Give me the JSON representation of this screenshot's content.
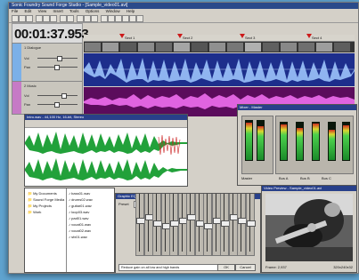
{
  "app": {
    "title": "Sonic Foundry Sound Forge Studio - [Sample_video01.avi]",
    "menu": [
      "File",
      "Edit",
      "View",
      "Insert",
      "Tools",
      "Options",
      "Window",
      "Help"
    ]
  },
  "transport": {
    "time": "00:01:37.953"
  },
  "tracks": [
    {
      "name": "1 Dialogue",
      "vol_label": "Vol",
      "pan_label": "Pan"
    },
    {
      "name": "2 Music",
      "vol_label": "Vol",
      "pan_label": "Pan"
    }
  ],
  "ruler": {
    "markers": [
      "Sect 1",
      "Sect 2",
      "Sect 3",
      "Sect 4"
    ]
  },
  "wave_window": {
    "title": "Intro.wav - 44,100 Hz, 16-bit, Stereo"
  },
  "mixer_window": {
    "title": "Mixer - Master",
    "labels": [
      "Master",
      "Bus A",
      "Bus B",
      "Bus C"
    ]
  },
  "explorer": {
    "items": [
      "My Documents",
      "Sound Forge Media",
      "My Projects",
      "Work"
    ],
    "files": [
      "bass01.wav",
      "drums02.wav",
      "guitar01.wav",
      "loop03.wav",
      "pad01.wav",
      "vocal01.wav",
      "vocal02.wav",
      "sfx01.wav"
    ]
  },
  "eq_window": {
    "title": "Graphic EQ",
    "preset_label": "Preset",
    "preset_value": "[Untitled]",
    "bands": [
      0.55,
      0.6,
      0.5,
      0.45,
      0.5,
      0.55,
      0.6,
      0.5,
      0.45,
      0.55,
      0.5,
      0.6,
      0.55,
      0.5
    ],
    "hint": "Reduce gain on all low and high bands",
    "ok": "OK",
    "cancel": "Cancel"
  },
  "preview_window": {
    "title": "Video Preview - Sample_video01.avi",
    "frame_label": "Frame: 2,937",
    "size_label": "320x240x32"
  },
  "colors": {
    "wave_blue": "#8fb4f0",
    "wave_purple": "#e064e0",
    "wave_green": "#22a13a",
    "titlebar": "#28408a"
  }
}
